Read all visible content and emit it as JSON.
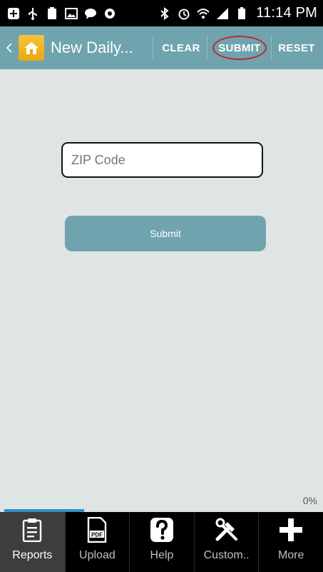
{
  "status_bar": {
    "time": "11:14 PM",
    "icons": [
      "add-icon",
      "usb-icon",
      "battery-saver-icon",
      "image-icon",
      "chat-icon",
      "camera-icon",
      "bluetooth-icon",
      "alarm-icon",
      "wifi-icon",
      "signal-icon",
      "battery-icon"
    ]
  },
  "header": {
    "title": "New Daily...",
    "clear_label": "CLEAR",
    "submit_label": "SUBMIT",
    "reset_label": "RESET"
  },
  "form": {
    "zip_placeholder": "ZIP Code",
    "zip_value": "",
    "submit_label": "Submit"
  },
  "progress": {
    "label": "0%",
    "value": 0
  },
  "bottom_tabs": [
    {
      "label": "Reports",
      "icon": "clipboard-icon",
      "active": true
    },
    {
      "label": "Upload",
      "icon": "pdf-icon",
      "active": false
    },
    {
      "label": "Help",
      "icon": "help-icon",
      "active": false
    },
    {
      "label": "Custom..",
      "icon": "tools-icon",
      "active": false
    },
    {
      "label": "More",
      "icon": "plus-icon",
      "active": false
    }
  ],
  "colors": {
    "action_bar": "#6fa3ae",
    "background": "#dfe4e4",
    "highlight_circle": "#c1272d",
    "progress": "#2f8fc4"
  }
}
